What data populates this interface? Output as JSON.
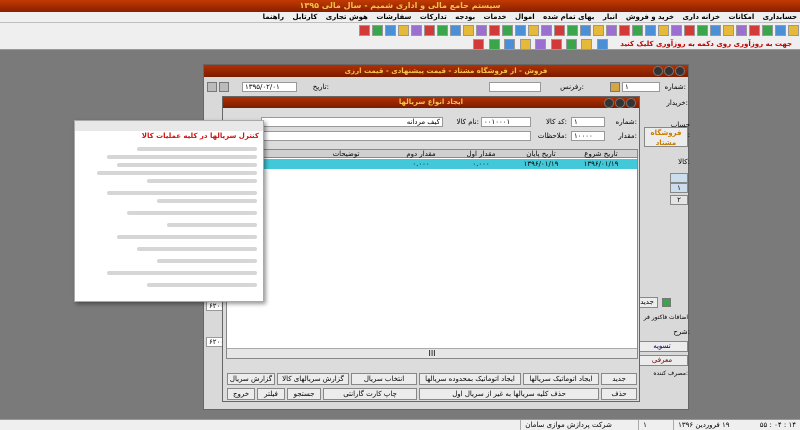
{
  "app_title": "سیستم جامع مالی و اداری شمیم - سال مالی ۱۳۹۵",
  "menu": [
    "حسابداری",
    "امکانات",
    "خزانه داری",
    "خرید و فروش",
    "انبار",
    "بهای تمام شده",
    "اموال",
    "خدمات",
    "بودجه",
    "تدارکات",
    "سفارشات",
    "هوش تجاری",
    "کارتابل",
    "راهنما"
  ],
  "hint": "جهت به روزآوری روی دکمه به روزآوری کلیک کنید",
  "parent_window": {
    "title": "فروش - از فروشگاه مشتاد - قیمت پیشنهادی - قیمت ارزی",
    "number_label": "شماره:",
    "number_value": "۱",
    "ref_label": "رفرنس:",
    "date_label": "تاریخ:",
    "date_value": "۱۳۹۵/۰۲/۰۱",
    "buyer_label": "خریدار:",
    "buyer_account_label": "حساب خریدار:",
    "goods_code_label": "کالا:",
    "store_btn": "فروشگاه مشتاد",
    "rows": [
      "۱",
      "۲"
    ],
    "new_btn": "جدید",
    "extra_label": "اضافات فاکتور فر",
    "desc_label": "شرح:",
    "confirm_label": "تسویه",
    "intro_label": "معرفی",
    "consumer_label": "مصرف کننده:",
    "left_values": [
      "۶۲۰۰",
      "۶۲۰۰"
    ]
  },
  "dialog": {
    "title": "ایجاد انواع سریالها",
    "number_label": "شماره:",
    "number_value": "۱",
    "code_label": "کد کالا:",
    "code_value": "۰۰۱۰۰۰۱",
    "name_label": "نام کالا:",
    "name_value": "کیف مردانه",
    "qty_label": "مقدار:",
    "qty_value": "۱۰۰۰۰",
    "notes_label": "ملاحظات:",
    "columns": [
      "تاریخ شروع",
      "تاریخ پایان",
      "مقدار اول",
      "مقدار دوم",
      "توضیحات"
    ],
    "row": [
      "۱۳۹۶/۰۱/۱۹",
      "۱۳۹۶/۰۱/۱۹",
      "۰.۰۰۰",
      "۰.۰۰۰",
      ""
    ],
    "buttons_row1": [
      "جدید",
      "ایجاد اتوماتیک سریالها",
      "ایجاد اتوماتیک بمحدوده سریالها",
      "انتخاب سریال",
      "گزارش سریالهای کالا",
      "گزارش سریال"
    ],
    "buttons_row2": [
      "حذف",
      "حذف کلیه سریالها به غیر از سریال اول",
      "چاپ کارت گارانتی",
      "جستجو",
      "فیلتر",
      "خروج"
    ],
    "scroll_mark": "III"
  },
  "popup": {
    "title": "کنترل سریالها در کلیه عملیات کالا"
  },
  "status": {
    "time": "۱۴ : ۰۴ : ۵۵",
    "date": "۱۹ فروردین ۱۳۹۶",
    "num": "۱",
    "company": "شرکت پردازش موازی سامان"
  }
}
